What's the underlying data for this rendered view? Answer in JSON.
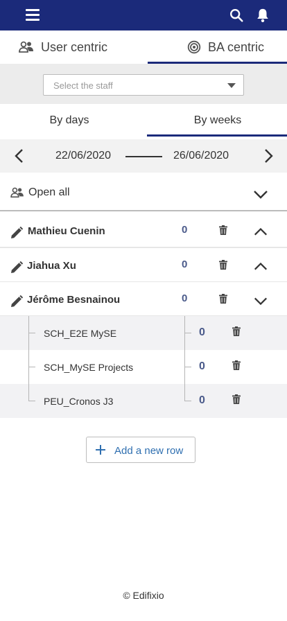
{
  "colors": {
    "header": "#1b2a7a",
    "value": "#4a5a8a",
    "link": "#2f6fb0"
  },
  "header": {
    "menu_icon": "hamburger-menu-icon",
    "search_icon": "search-icon",
    "notification_icon": "bell-icon"
  },
  "modes": {
    "user_centric": "User centric",
    "ba_centric": "BA centric",
    "active": "BA centric"
  },
  "staff_select": {
    "placeholder": "Select the staff"
  },
  "periods": {
    "by_days": "By days",
    "by_weeks": "By weeks",
    "active": "By weeks"
  },
  "date_range": {
    "start": "22/06/2020",
    "end": "26/06/2020"
  },
  "open_all": {
    "label": "Open all"
  },
  "people": [
    {
      "name": "Mathieu Cuenin",
      "value": "0",
      "expanded": true
    },
    {
      "name": "Jiahua Xu",
      "value": "0",
      "expanded": true
    },
    {
      "name": "Jérôme Besnainou",
      "value": "0",
      "expanded": false
    }
  ],
  "projects": [
    {
      "name": "SCH_E2E MySE",
      "value": "0"
    },
    {
      "name": "SCH_MySE Projects",
      "value": "0"
    },
    {
      "name": "PEU_Cronos J3",
      "value": "0"
    }
  ],
  "add_row": {
    "label": "Add a new row"
  },
  "footer": {
    "copyright": "© Edifixio"
  }
}
